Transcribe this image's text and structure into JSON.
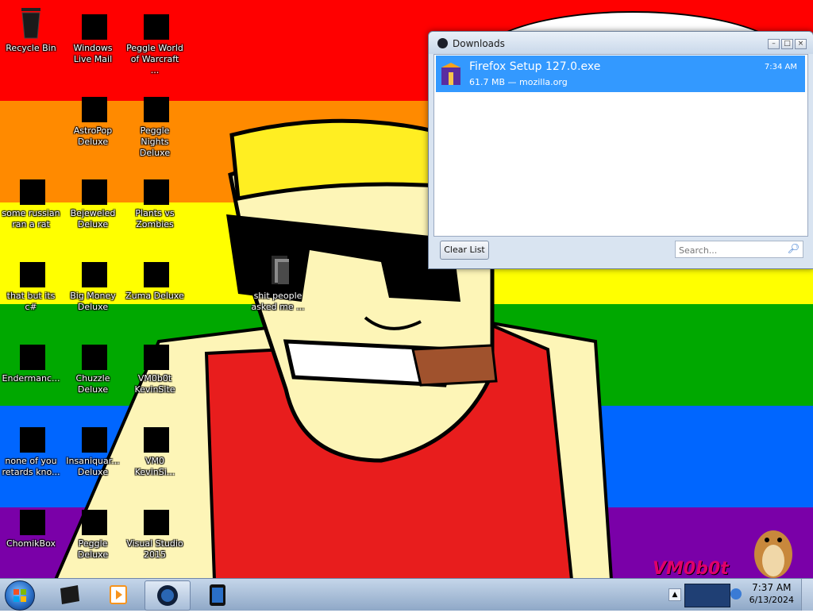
{
  "desktop": {
    "icons": [
      {
        "label": "Recycle Bin",
        "icon": "recycle-bin-icon"
      },
      {
        "label": "Windows Live Mail",
        "icon": "mail-icon"
      },
      {
        "label": "Peggle World of Warcraft ...",
        "icon": "peggle-icon"
      },
      {
        "label": "AstroPop Deluxe",
        "icon": "game-icon"
      },
      {
        "label": "Peggle Nights Deluxe",
        "icon": "peggle-icon"
      },
      {
        "label": "some russian ran a rat",
        "icon": "app-icon"
      },
      {
        "label": "Bejeweled Deluxe",
        "icon": "gem-icon"
      },
      {
        "label": "Plants vs Zombies",
        "icon": "game-icon"
      },
      {
        "label": "that but its c#",
        "icon": "folder-icon"
      },
      {
        "label": "Big Money Deluxe",
        "icon": "game-icon"
      },
      {
        "label": "Zuma Deluxe",
        "icon": "game-icon"
      },
      {
        "label": "shit people asked me ...",
        "icon": "folder-icon"
      },
      {
        "label": "Endermanc...",
        "icon": "app-icon"
      },
      {
        "label": "Chuzzle Deluxe",
        "icon": "game-icon"
      },
      {
        "label": "VM0b0t KevinSite",
        "icon": "app-icon"
      },
      {
        "label": "none of you retards kno...",
        "icon": "app-icon"
      },
      {
        "label": "Insaniquar... Deluxe",
        "icon": "game-icon"
      },
      {
        "label": "VM0 KevinSi...",
        "icon": "document-icon"
      },
      {
        "label": "ChomikBox",
        "icon": "app-icon"
      },
      {
        "label": "Peggle Deluxe",
        "icon": "peggle-icon"
      },
      {
        "label": "Visual Studio 2015",
        "icon": "visual-studio-icon"
      }
    ],
    "watermark": "VM0b0t",
    "colors": {
      "red": "#ff0000",
      "orange": "#ff8a00",
      "yellow": "#ffff00",
      "green": "#00a800",
      "blue": "#0066ff",
      "purple": "#7a00a8"
    }
  },
  "downloads": {
    "title": "Downloads",
    "items": [
      {
        "name": "Firefox Setup 127.0.exe",
        "meta": "61.7 MB — mozilla.org",
        "time": "7:34 AM"
      }
    ],
    "clear_label": "Clear List",
    "search_placeholder": "Search..."
  },
  "taskbar": {
    "time": "7:37 AM",
    "date": "6/13/2024"
  }
}
